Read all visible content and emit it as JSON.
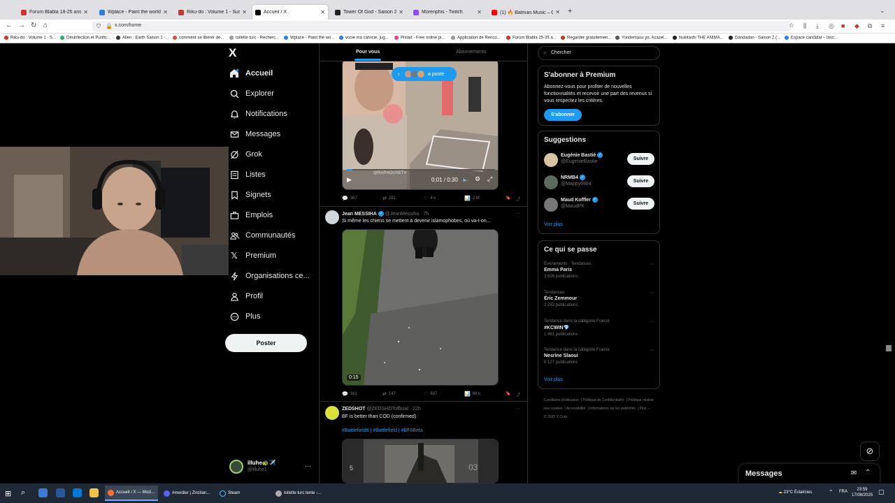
{
  "browser": {
    "tabs": [
      {
        "label": "Forum Blabla 18-25 ans - jeuxv",
        "active": false,
        "color": "#d0312d"
      },
      {
        "label": "Wplace - Paint the world",
        "active": false,
        "color": "#2b7de9"
      },
      {
        "label": "Riku-do : Volume 1 - Sushiscan",
        "active": false,
        "color": "#c0392b"
      },
      {
        "label": "Accueil / X",
        "active": true,
        "color": "#000000"
      },
      {
        "label": "Tower Of God - Saison 2 | Anime",
        "active": false,
        "color": "#222222"
      },
      {
        "label": "Morenphis - Twitch",
        "active": false,
        "color": "#9146ff"
      },
      {
        "label": "(1) 🔥 Batman Music – Cinemat",
        "active": false,
        "color": "#ff0000"
      }
    ],
    "url": "x.com/home",
    "bookmarks": [
      "Riku-do : Volume 1 - S...",
      "Désinfection et Purific...",
      "Alien : Earth Saison 1 -...",
      "comment se liberer de...",
      "toilette turc - Recherc...",
      "Wplace - Paint the wo...",
      "vocie ma calvicie, jug...",
      "Pixlart - Free online pi...",
      "Application de Renco...",
      "Forum Blabla 25-35 a...",
      "Regarder gratuitemen...",
      "Yondemasu yo, Azazel...",
      "Nukitashi THE ANIMA...",
      "Dandadan - Saison 2 (...",
      "Espace candidat – Insc..."
    ]
  },
  "sidebar": {
    "logo": "X",
    "items": [
      {
        "label": "Accueil",
        "icon": "home-icon"
      },
      {
        "label": "Explorer",
        "icon": "search-icon"
      },
      {
        "label": "Notifications",
        "icon": "bell-icon"
      },
      {
        "label": "Messages",
        "icon": "mail-icon"
      },
      {
        "label": "Grok",
        "icon": "grok-icon"
      },
      {
        "label": "Listes",
        "icon": "list-icon"
      },
      {
        "label": "Signets",
        "icon": "bookmark-icon"
      },
      {
        "label": "Emplois",
        "icon": "briefcase-icon"
      },
      {
        "label": "Communautés",
        "icon": "people-icon"
      },
      {
        "label": "Premium",
        "icon": "x-icon"
      },
      {
        "label": "Organisations ce...",
        "icon": "lightning-icon"
      },
      {
        "label": "Profil",
        "icon": "person-icon"
      },
      {
        "label": "Plus",
        "icon": "more-circle-icon"
      }
    ],
    "post_button": "Poster",
    "account": {
      "name": "illuhe🐢✈️",
      "handle": "@Illuhe1"
    }
  },
  "feed": {
    "tabs": [
      "Pour vous",
      "Abonnements"
    ],
    "new_posts_pill": "a posté",
    "post1": {
      "watermark": "@RAPHOUSETV",
      "video_time": "0:01 / 0:30",
      "replies": "387",
      "reposts": "281",
      "likes": "4 k",
      "views": "2 M"
    },
    "post2": {
      "name": "Jean MESSIHA",
      "handle": "@JeanMessiha · 7h",
      "text": "Si même les chiens se mettent à devenir islamophobes, où va-t-on...",
      "duration": "0:15",
      "replies": "161",
      "reposts": "147",
      "likes": "887",
      "views": "66 k"
    },
    "post3": {
      "name": "ZEDSHOT",
      "handle": "@ZEDSHOTofficial · 22h",
      "text": "BF is better than COD (confirmed)",
      "hashtags": "#Battlefield6 | #Battlefield | #BF6Beta"
    }
  },
  "right": {
    "search_placeholder": "Chercher",
    "premium": {
      "title": "S'abonner à Premium",
      "text": "Abonnez-vous pour profiter de nouvelles fonctionnalités et recevoir une part des revenus si vous respectez les critères.",
      "button": "S'abonner"
    },
    "suggestions": {
      "title": "Suggestions",
      "users": [
        {
          "name": "Eugénie Bastié",
          "handle": "@EugenieBastie",
          "button": "Suivre"
        },
        {
          "name": "NRMB4",
          "handle": "@Mappy6984",
          "button": "Suivre"
        },
        {
          "name": "Maud Koffler",
          "handle": "@MaudPK",
          "button": "Suivre"
        }
      ],
      "see_more": "Voir plus"
    },
    "trends": {
      "title": "Ce qui se passe",
      "items": [
        {
          "context": "Évènements · Tendances",
          "topic": "Emma Paris",
          "count": "3 826 publications"
        },
        {
          "context": "Tendances",
          "topic": "Éric Zemmour",
          "count": "2 283 publications"
        },
        {
          "context": "Tendance dans la catégorie France",
          "topic": "#KCWIN💎",
          "count": "1 461 publications"
        },
        {
          "context": "Tendance dans la catégorie France",
          "topic": "Nesrine Slaoui",
          "count": "6 127 publications"
        }
      ],
      "see_more": "Voir plus"
    },
    "footer": [
      "Conditions d'utilisation",
      "Politique de Confidentialité",
      "Politique relative aux cookies",
      "Accessibilité",
      "Informations sur les publicités",
      "Plus ···",
      "© 2025 X Corp."
    ]
  },
  "messages_drawer": {
    "title": "Messages"
  },
  "taskbar": {
    "apps": [
      "Accueil / X — Mozi...",
      "#merdier | Zinzilan...",
      "Steam",
      "toilette turc tente -..."
    ],
    "weather": "23°C  Éclaircies",
    "language": "FRA",
    "time": "23:59",
    "date": "17/08/2025"
  }
}
